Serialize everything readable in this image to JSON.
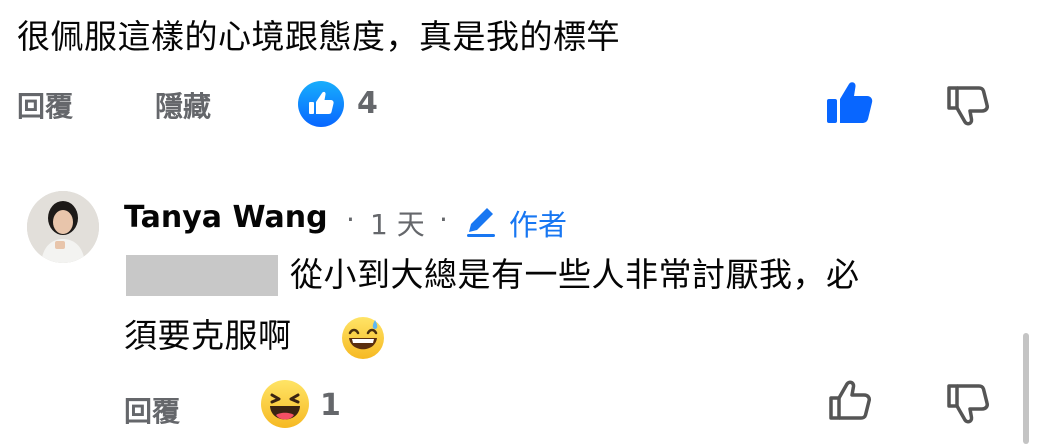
{
  "comment1": {
    "text": "很佩服這樣的心境跟態度，真是我的標竿",
    "reply_label": "回覆",
    "hide_label": "隱藏",
    "like_count": "4"
  },
  "reply": {
    "author_name": "Tanya Wang",
    "separator": "·",
    "time": "1 天",
    "author_badge": "作者",
    "text_line1": "從小到大總是有一些人非常討厭我，必",
    "text_line2": "須要克服啊",
    "emoji": "😅",
    "reply_label": "回覆",
    "reaction_count": "1"
  },
  "colors": {
    "accent": "#1877f2",
    "muted": "#65676b",
    "text": "#050505"
  },
  "icons": {
    "like_badge": "thumbs-up-badge-icon",
    "like_filled": "thumbs-up-filled-icon",
    "dislike": "thumbs-down-icon",
    "like_outline": "thumbs-up-outline-icon",
    "reaction": "haha-emoji-icon",
    "pencil": "pencil-icon"
  }
}
